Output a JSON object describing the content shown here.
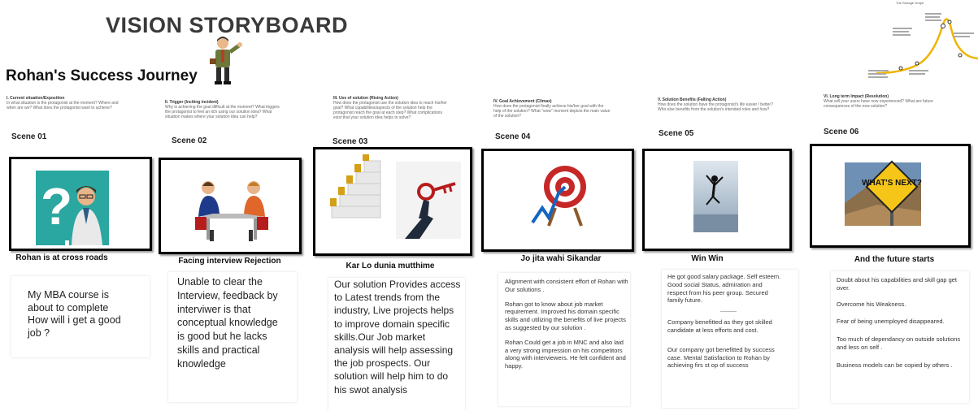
{
  "header": {
    "title": "VISION STORYBOARD",
    "subtitle": "Rohan's Success Journey"
  },
  "mini_map": {
    "heading": "The Storage Graph"
  },
  "scenes": [
    {
      "q_title": "I. Current situation/Exposition",
      "q_text": "In what situation is the protagonist at the moment? Where and when are we? What does the protagonist want to achieve?",
      "label": "Scene 01",
      "caption": "Rohan is at cross roads",
      "story": "My  MBA course is about to complete How will i get a good job ?"
    },
    {
      "q_title": "II. Trigger (Inciting incident)",
      "q_text": "Why is achieving the goal difficult at the moment? What triggers the protagonist to feel an itch using our solution idea? What situation makes where your solution idea can help?",
      "label": "Scene 02",
      "caption": "Facing interview Rejection",
      "story": "Unable to clear the Interview, feedback by interviwer is that conceptual knowledge is good but  he lacks  skills and practical knowledge"
    },
    {
      "q_title": "III. Use of solution (Rising Action)",
      "q_text": "How does the protagonist use the solution idea to reach his/her goal? What capabilities/aspects of the solution help the protagonist reach the goal at each step? What complications exist that your solution idea helps to solve?",
      "label": "Scene 03",
      "caption": "Kar Lo dunia mutthime",
      "story": "Our solution Provides access to Latest trends from the industry,  Live projects helps to improve domain specific skills.Our Job market analysis will help assessing the job prospects. Our solution will help him to do his swot analysis"
    },
    {
      "q_title": "IV. Goal Achievement (Climax)",
      "q_text": "How does the protagonist finally achieve his/her goal with the help of the solution? What \"wow\" moment depicts the main value of the solution?",
      "label": "Scene 04",
      "caption": "Jo jita wahi Sikandar",
      "story": [
        "Alignment with consistent effort of Rohan with Our solutions .",
        "Rohan got to know about job market requirement. Improved his domain specific skills and utilizing the benefits of live projects as suggested by our solution .",
        "Rohan Could get a job in MNC and also laid a  very strong impression on his competitors along with interviewers. He felt confident and happy."
      ]
    },
    {
      "q_title": "V. Solution Benefits (Falling Action)",
      "q_text": "How does the solution have the protagonist's life easier / better? Who else benefits from the solution's intended roles and how?",
      "label": "Scene 05",
      "caption": "Win Win",
      "story": [
        "He got good salary package. Self esteem. Good social Status, admiration and respect from his peer group. Secured family future.",
        "Company benefitted as they got skilled candidate at less efforts and cost.",
        "Our company got benefitted by success case. Mental Satisfaction to Rohan by achieving firs st op of success"
      ]
    },
    {
      "q_title": "VI. Long term Impact (Resolution)",
      "q_text": "What will your users have now experienced? What are future consequences of the new solution?",
      "label": "Scene 06",
      "caption": "And the future starts",
      "story": [
        "Doubt  about his capabilities and skill gap get over.",
        "Overcome his  Weakness.",
        "Fear of being unemployed disappeared.",
        "Too much of dependancy on outside solutions and less on self .",
        "Business models can be copied by others ."
      ]
    }
  ],
  "images": {
    "s4_sign": "WHAT'S NEXT?"
  }
}
